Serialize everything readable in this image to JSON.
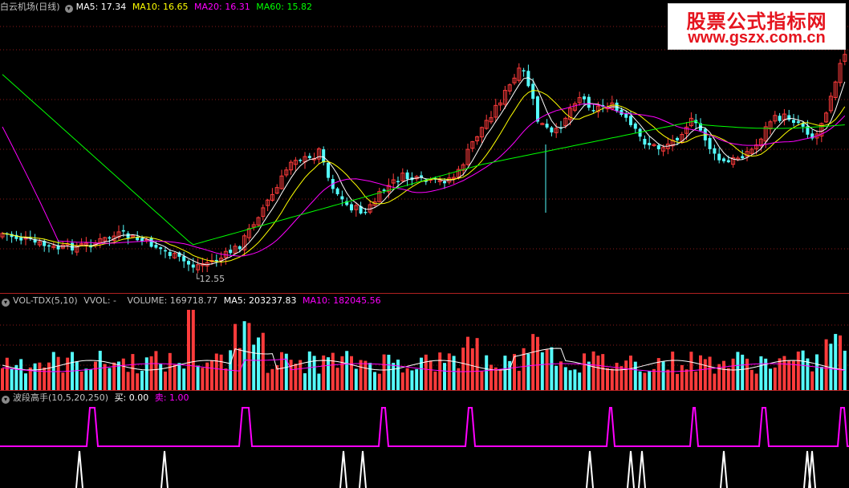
{
  "colors": {
    "up": "#ff3b3b",
    "down": "#54fcfc",
    "ma5": "#ffffff",
    "ma10": "#ffff00",
    "ma20": "#ff00ff",
    "ma60": "#00ff00",
    "grid": "#8b1a1a",
    "divider": "#b02020",
    "label": "#c0c0c0"
  },
  "price_panel": {
    "symbol": "白云机场(日线)",
    "ma5_label": "MA5: 17.34",
    "ma10_label": "MA10: 16.65",
    "ma20_label": "MA20: 16.31",
    "ma60_label": "MA60: 15.82",
    "low_marker": "12.55"
  },
  "volume_panel": {
    "title": "VOL-TDX(5,10)",
    "vvol_label": "VVOL: -",
    "volume_label": "VOLUME: 169718.77",
    "ma5_label": "MA5: 203237.83",
    "ma10_label": "MA10: 182045.56"
  },
  "indicator_panel": {
    "title": "波段高手(10,5,20,250)",
    "buy_label": "买: 0.00",
    "sell_label": "卖: 1.00"
  },
  "watermark": {
    "line1": "股票公式指标网",
    "line2": "www.gszx.com.cn"
  },
  "icons": {
    "panel_toggle": "circle-chevron-icon"
  }
}
